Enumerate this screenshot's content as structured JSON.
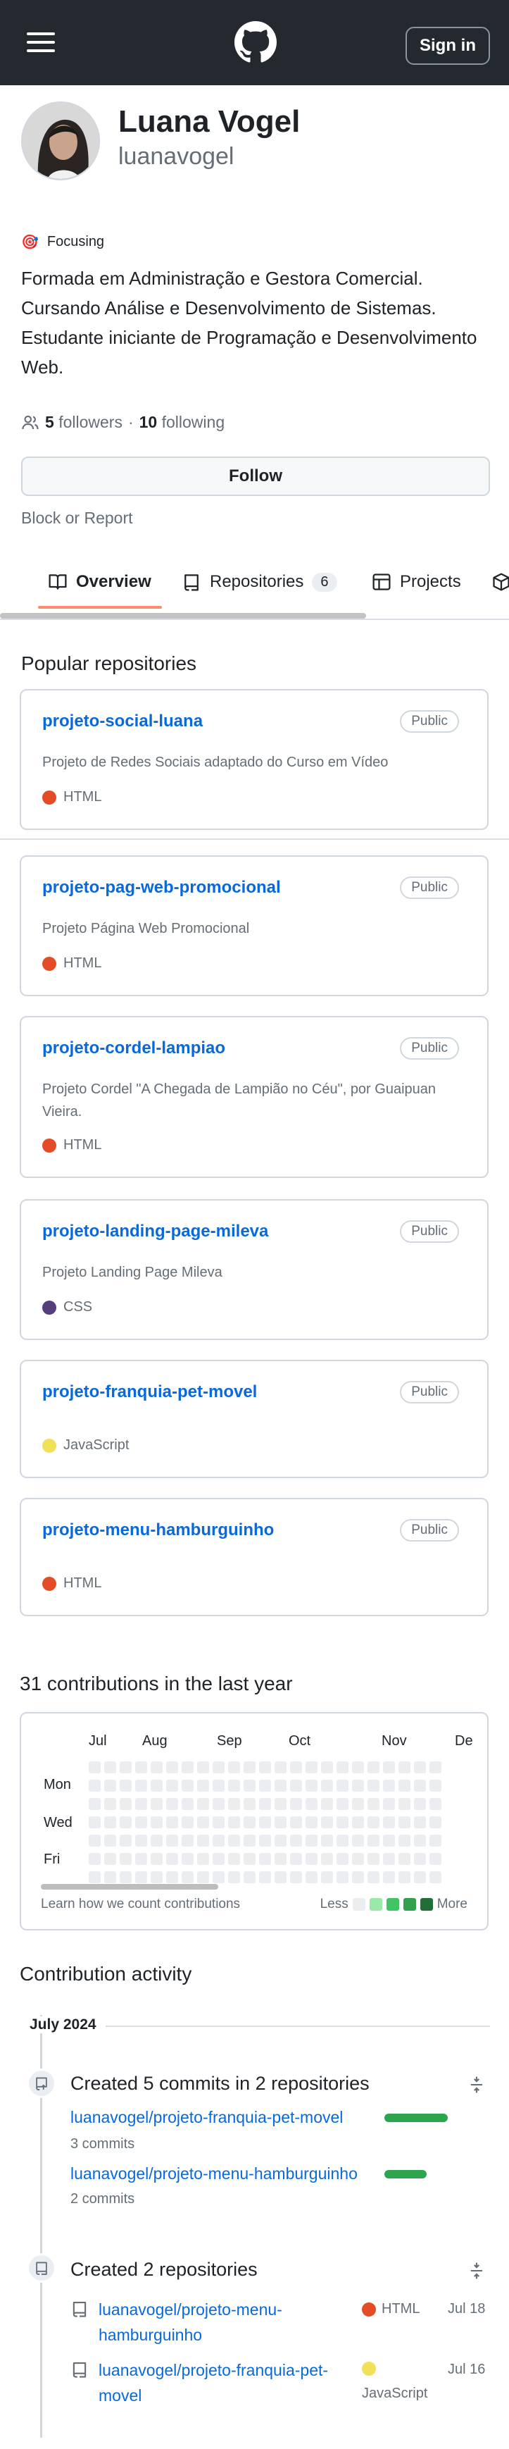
{
  "header": {
    "menu_icon": "hamburger-icon",
    "logo_icon": "github-logo-icon",
    "sign_in_label": "Sign in"
  },
  "profile": {
    "full_name": "Luana Vogel",
    "username": "luanavogel",
    "status_emoji": "🎯",
    "status_text": "Focusing",
    "bio": "Formada em Administração e Gestora Comercial. Cursando Análise e Desenvolvimento de Sistemas. Estudante iniciante de Programação e Desenvolvimento Web.",
    "followers_count": "5",
    "followers_label": "followers",
    "separator": "·",
    "following_count": "10",
    "following_label": "following",
    "follow_label": "Follow",
    "block_report_label": "Block or Report"
  },
  "tabs": [
    {
      "label": "Overview",
      "icon": "book-icon",
      "active": true
    },
    {
      "label": "Repositories",
      "icon": "repo-icon",
      "count": "6"
    },
    {
      "label": "Projects",
      "icon": "table-icon"
    },
    {
      "label": "",
      "icon": "package-icon"
    }
  ],
  "popular": {
    "title": "Popular repositories",
    "repos": [
      {
        "name": "projeto-social-luana",
        "visibility": "Public",
        "description": "Projeto de Redes Sociais adaptado do Curso em Vídeo",
        "language": "HTML",
        "lang_color": "#e34c26"
      },
      {
        "name": "projeto-pag-web-promocional",
        "visibility": "Public",
        "description": "Projeto Página Web Promocional",
        "language": "HTML",
        "lang_color": "#e34c26"
      },
      {
        "name": "projeto-cordel-lampiao",
        "visibility": "Public",
        "description": "Projeto Cordel \"A Chegada de Lampião no Céu\", por Guaipuan Vieira.",
        "language": "HTML",
        "lang_color": "#e34c26"
      },
      {
        "name": "projeto-landing-page-mileva",
        "visibility": "Public",
        "description": "Projeto Landing Page Mileva",
        "language": "CSS",
        "lang_color": "#563d7c"
      },
      {
        "name": "projeto-franquia-pet-movel",
        "visibility": "Public",
        "description": "",
        "language": "JavaScript",
        "lang_color": "#f1e05a"
      },
      {
        "name": "projeto-menu-hamburguinho",
        "visibility": "Public",
        "description": "",
        "language": "HTML",
        "lang_color": "#e34c26"
      }
    ]
  },
  "contributions": {
    "title": "31 contributions in the last year",
    "months": [
      "Jul",
      "Aug",
      "Sep",
      "Oct",
      "Nov",
      "De"
    ],
    "days": [
      "Mon",
      "Wed",
      "Fri"
    ],
    "learn_link": "Learn how we count contributions",
    "legend_less": "Less",
    "legend_more": "More",
    "legend_colors": [
      "#ebedf0",
      "#9be9a8",
      "#40c463",
      "#30a14e",
      "#216e39"
    ]
  },
  "activity": {
    "title": "Contribution activity",
    "period": "July 2024",
    "commits_title": "Created 5 commits in 2 repositories",
    "commit_repos": [
      {
        "name": "luanavogel/projeto-franquia-pet-movel",
        "commits": "3 commits",
        "share": 0.6
      },
      {
        "name": "luanavogel/projeto-menu-hamburguinho",
        "commits": "2 commits",
        "share": 0.4
      }
    ],
    "created_title": "Created 2 repositories",
    "created_repos": [
      {
        "name": "luanavogel/projeto-menu-hamburguinho",
        "language": "HTML",
        "lang_color": "#e34c26",
        "date": "Jul 18"
      },
      {
        "name": "luanavogel/projeto-franquia-pet-movel",
        "language": "JavaScript",
        "lang_color": "#f1e05a",
        "date": "Jul 16"
      }
    ]
  }
}
